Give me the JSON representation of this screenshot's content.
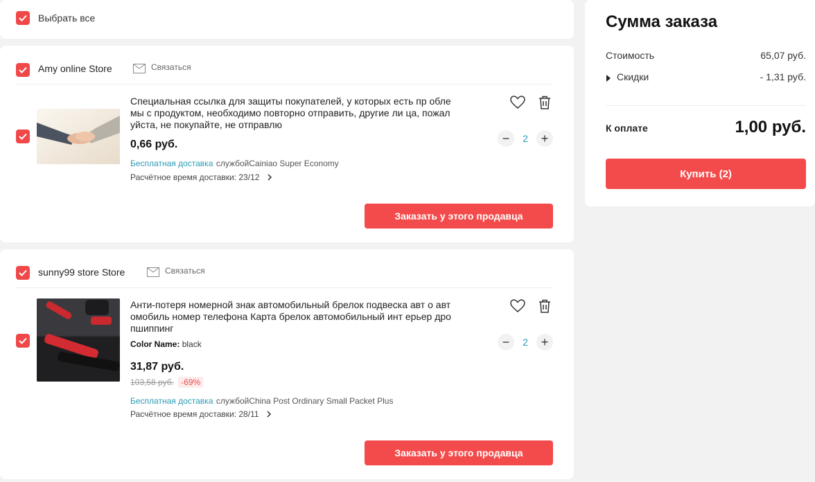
{
  "select_all": {
    "label": "Выбрать все"
  },
  "stores": [
    {
      "name": "Amy online Store",
      "contact_label": "Связаться",
      "item": {
        "title": "Специальная ссылка для защиты покупателей, у которых есть пр облемы с продуктом, необходимо повторно отправить, другие ли ца, пожалуйста, не покупайте, не отправлю",
        "price": "0,66 руб.",
        "shipping_free": "Бесплатная доставка",
        "shipping_service": "службойCainiao Super Economy",
        "eta": "Расчётное время доставки: 23/12",
        "quantity": "2"
      },
      "order_button": "Заказать у этого продавца"
    },
    {
      "name": "sunny99 store Store",
      "contact_label": "Связаться",
      "item": {
        "title": "Анти-потеря номерной знак автомобильный брелок подвеска авт о автомобиль номер телефона Карта брелок автомобильный инт ерьер дропшиппинг",
        "variant_label": "Color Name:",
        "variant_value": "black",
        "price": "31,87 руб.",
        "old_price": "103,58 руб.",
        "discount": "-69%",
        "shipping_free": "Бесплатная доставка",
        "shipping_service": "службойChina Post Ordinary Small Packet Plus",
        "eta": "Расчётное время доставки: 28/11",
        "quantity": "2"
      },
      "order_button": "Заказать у этого продавца"
    }
  ],
  "summary": {
    "title": "Сумма заказа",
    "cost_label": "Стоимость",
    "cost_value": "65,07 руб.",
    "discount_label": "Скидки",
    "discount_value": "- 1,31 руб.",
    "total_label": "К оплате",
    "total_value": "1,00 руб.",
    "buy_button": "Купить (2)"
  },
  "colors": {
    "accent": "#f34b4b",
    "checkbox": "#f04848",
    "link": "#2a9bb5"
  }
}
